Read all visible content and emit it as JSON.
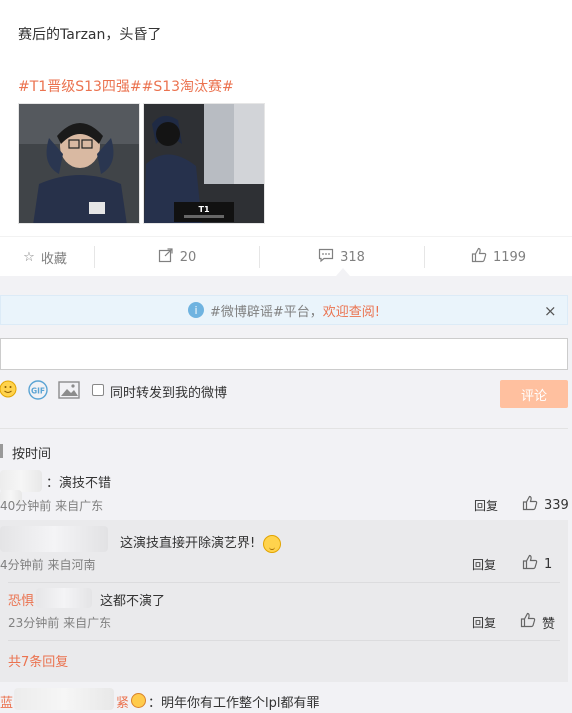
{
  "post": {
    "text": "赛后的Tarzan，头昏了",
    "tags": "#T1晋级S13四强##S13淘汰赛#",
    "image2_caption": "T1"
  },
  "actions": {
    "collect_label": "收藏",
    "repost_count": "20",
    "comment_count": "318",
    "like_count": "1199"
  },
  "notice": {
    "text": "#微博辟谣#平台，",
    "link": "欢迎查阅!",
    "close": "×"
  },
  "composer": {
    "input_placeholder": "",
    "share_label": "同时转发到我的微博",
    "submit_label": "评论",
    "gif_label": "GIF"
  },
  "sort": {
    "label": "按时间"
  },
  "comments": [
    {
      "text": "：演技不错",
      "meta": "40分钟前 来自广东",
      "reply": "回复",
      "likes": "339"
    }
  ],
  "sub_comments": [
    {
      "text": "这演技直接开除演艺界!",
      "meta": "4分钟前 来自河南",
      "reply": "回复",
      "likes": "1"
    },
    {
      "name_prefix": "恐惧",
      "text": "这都不演了",
      "meta": "23分钟前 来自广东",
      "reply": "回复",
      "likes": "赞"
    }
  ],
  "more_replies": "共7条回复",
  "last_comment": {
    "name_prefix": "蓝",
    "name_suffix": "紧",
    "text": "：明年你有工作整个lpl都有罪"
  },
  "colors": {
    "accent": "#eb7350",
    "background": "#f2f2f5",
    "submit": "#ffc09f"
  }
}
